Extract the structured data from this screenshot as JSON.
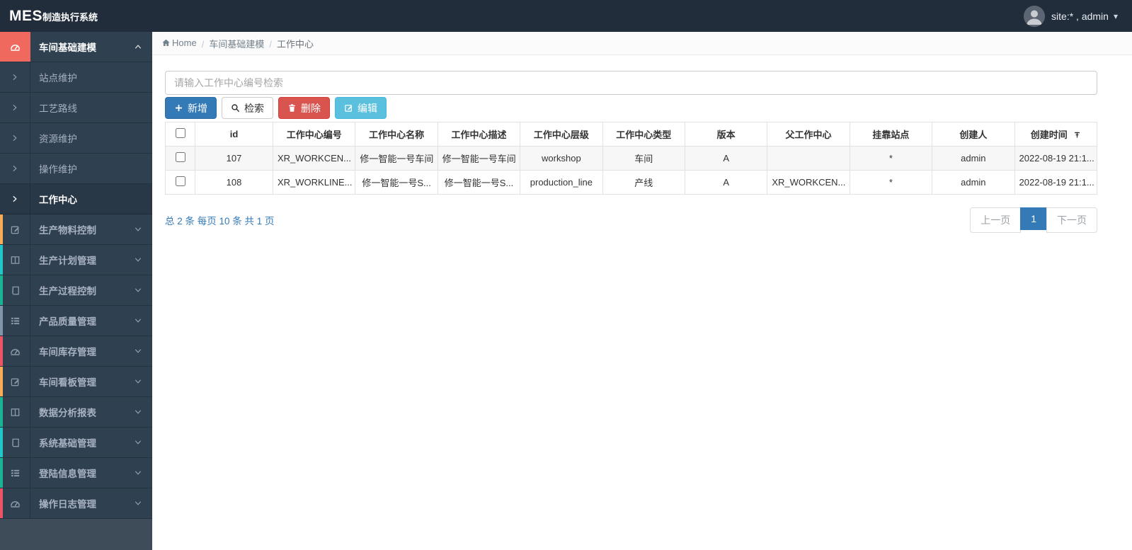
{
  "topbar": {
    "logo_primary": "MES",
    "logo_secondary": "制造执行系统",
    "user_label": "site:* , admin"
  },
  "breadcrumb": {
    "items": [
      "Home",
      "车间基础建模",
      "工作中心"
    ]
  },
  "sidebar": {
    "items": [
      {
        "label": "车间基础建模",
        "icon": "dashboard-icon",
        "kind": "parent",
        "active": true,
        "accent": "#f0695f",
        "chevron": "up"
      },
      {
        "label": "站点维护",
        "icon": "chevron-right-icon",
        "kind": "sub",
        "active": false
      },
      {
        "label": "工艺路线",
        "icon": "chevron-right-icon",
        "kind": "sub",
        "active": false
      },
      {
        "label": "资源维护",
        "icon": "chevron-right-icon",
        "kind": "sub",
        "active": false
      },
      {
        "label": "操作维护",
        "icon": "chevron-right-icon",
        "kind": "sub",
        "active": false
      },
      {
        "label": "工作中心",
        "icon": "chevron-right-icon",
        "kind": "sub",
        "active": true
      },
      {
        "label": "生产物料控制",
        "icon": "edit-icon",
        "kind": "parent",
        "accent": "#f8ac59",
        "chevron": "down"
      },
      {
        "label": "生产计划管理",
        "icon": "columns-icon",
        "kind": "parent",
        "accent": "#23c6c8",
        "chevron": "down"
      },
      {
        "label": "生产过程控制",
        "icon": "book-icon",
        "kind": "parent",
        "accent": "#1ab394",
        "chevron": "down"
      },
      {
        "label": "产品质量管理",
        "icon": "list-icon",
        "kind": "parent",
        "accent": "#8095a8",
        "chevron": "down"
      },
      {
        "label": "车间库存管理",
        "icon": "dashboard-icon",
        "kind": "parent",
        "accent": "#ed5565",
        "chevron": "down"
      },
      {
        "label": "车间看板管理",
        "icon": "edit-icon",
        "kind": "parent",
        "accent": "#f8ac59",
        "chevron": "down"
      },
      {
        "label": "数据分析报表",
        "icon": "columns-icon",
        "kind": "parent",
        "accent": "#1ab394",
        "chevron": "down"
      },
      {
        "label": "系统基础管理",
        "icon": "book-icon",
        "kind": "parent",
        "accent": "#23c6c8",
        "chevron": "down"
      },
      {
        "label": "登陆信息管理",
        "icon": "list-icon",
        "kind": "parent",
        "accent": "#1ab394",
        "chevron": "down"
      },
      {
        "label": "操作日志管理",
        "icon": "dashboard-icon",
        "kind": "parent",
        "accent": "#ed5565",
        "chevron": "down"
      }
    ]
  },
  "search": {
    "placeholder": "请输入工作中心编号检索"
  },
  "toolbar": {
    "buttons": [
      {
        "label": "新增",
        "icon": "plus-icon",
        "style": "primary",
        "name": "add-button"
      },
      {
        "label": "检索",
        "icon": "search-icon",
        "style": "default",
        "name": "search-button"
      },
      {
        "label": "删除",
        "icon": "trash-icon",
        "style": "danger",
        "name": "delete-button"
      },
      {
        "label": "编辑",
        "icon": "edit-square-icon",
        "style": "info",
        "name": "edit-button"
      }
    ]
  },
  "table": {
    "columns": [
      "id",
      "工作中心编号",
      "工作中心名称",
      "工作中心描述",
      "工作中心层级",
      "工作中心类型",
      "版本",
      "父工作中心",
      "挂靠站点",
      "创建人",
      "创建时间"
    ],
    "pin_column": "创建时间",
    "rows": [
      [
        "107",
        "XR_WORKCEN...",
        "修一智能一号车间",
        "修一智能一号车间",
        "workshop",
        "车间",
        "A",
        "",
        "*",
        "admin",
        "2022-08-19 21:1..."
      ],
      [
        "108",
        "XR_WORKLINE...",
        "修一智能一号S...",
        "修一智能一号S...",
        "production_line",
        "产线",
        "A",
        "XR_WORKCEN...",
        "*",
        "admin",
        "2022-08-19 21:1..."
      ]
    ]
  },
  "footer": {
    "summary": "总 2 条 每页 10 条 共 1 页",
    "prev": "上一页",
    "page": "1",
    "next": "下一页"
  },
  "colors": {
    "topbar_bg": "#222d3b",
    "sidebar_bg": "#2f4050",
    "active_menu_accent": "#f0695f",
    "primary": "#337ab7",
    "danger": "#d9534f",
    "info": "#5bc0de",
    "link_blue": "#337ab7"
  }
}
